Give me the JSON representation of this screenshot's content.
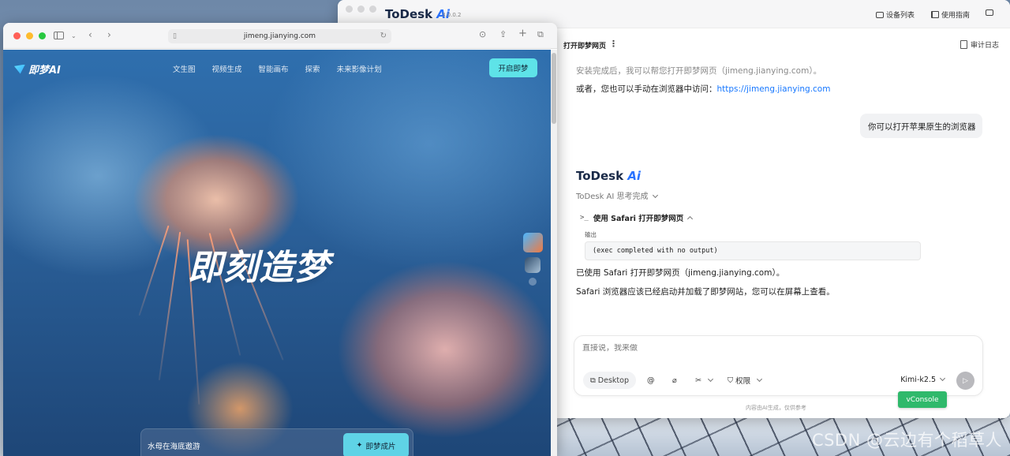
{
  "todesk": {
    "brand": "ToDesk",
    "brand_ai": "Ai",
    "version": "3.0.0.2",
    "top_buttons": {
      "devices": "设备列表",
      "guide": "使用指南"
    },
    "session_title": "打开即梦网页",
    "session_more": "⋮",
    "audit_log": "审计日志",
    "messages": {
      "line1": "安装完成后，我可以帮您打开即梦网页（jimeng.jianying.com）。",
      "line2_prefix": "或者，您也可以手动在浏览器中访问：",
      "line2_link": "https://jimeng.jianying.com",
      "user_bubble": "你可以打开苹果原生的浏览器",
      "ai_brand": "ToDesk",
      "ai_brand_suffix": "Ai",
      "think_status": "ToDesk AI 思考完成",
      "tool_call": "使用 Safari 打开即梦网页",
      "output_label": "输出",
      "output_code": "(exec completed with no output)",
      "result1": "已使用 Safari 打开即梦网页（jimeng.jianying.com）。",
      "result2": "Safari 浏览器应该已经启动并加载了即梦网站，您可以在屏幕上查看。"
    },
    "input": {
      "placeholder": "直接说，我来做",
      "desktop_label": "Desktop",
      "permission_label": "权限",
      "model": "Kimi-k2.5"
    },
    "vconsole": "vConsole",
    "disclaimer": "内容由AI生成，仅供参考"
  },
  "safari": {
    "url": "jimeng.jianying.com",
    "traffic_colors": [
      "#ff5f57",
      "#febc2e",
      "#28c840"
    ]
  },
  "jimeng": {
    "logo": "即梦AI",
    "nav": [
      "文生图",
      "视频生成",
      "智能画布",
      "探索",
      "未来影像计划"
    ],
    "cta": "开启即梦",
    "hero": "即刻造梦",
    "prompt_text": "水母在海底遨游",
    "generate_button": "即梦成片"
  },
  "watermark": "CSDN @云边有个稻草人"
}
